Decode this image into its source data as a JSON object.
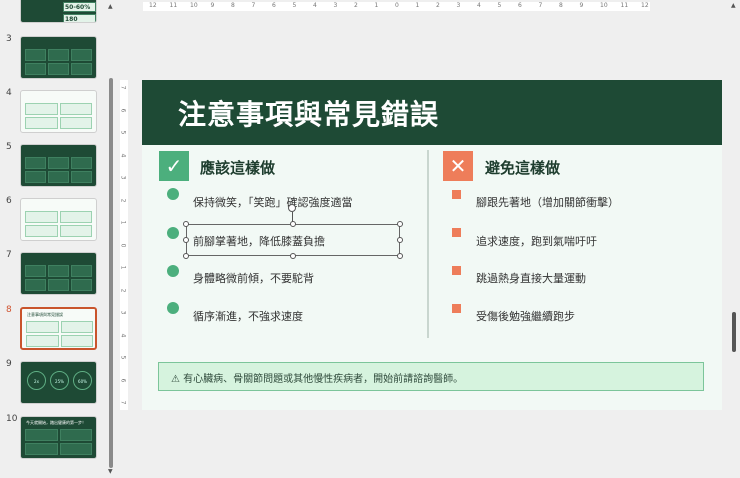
{
  "slides_panel": {
    "selected": 8,
    "thumbnails": [
      {
        "number": "3",
        "style": "dark"
      },
      {
        "number": "4",
        "style": "light"
      },
      {
        "number": "5",
        "style": "dark"
      },
      {
        "number": "6",
        "style": "light"
      },
      {
        "number": "7",
        "style": "dark"
      },
      {
        "number": "8",
        "style": "light",
        "title": "注意事項與常見錯誤"
      },
      {
        "number": "9",
        "style": "dark",
        "stats": [
          "2x",
          "25%",
          "60%"
        ]
      },
      {
        "number": "10",
        "style": "dark",
        "title": "今天就開始，踏出健康的第一步！"
      }
    ],
    "partial_slide2_values": [
      "50-60%",
      "180"
    ]
  },
  "ruler": {
    "horizontal": [
      "12",
      "11",
      "10",
      "9",
      "8",
      "7",
      "6",
      "5",
      "4",
      "3",
      "2",
      "1",
      "0",
      "1",
      "2",
      "3",
      "4",
      "5",
      "6",
      "7",
      "8",
      "9",
      "10",
      "11",
      "12"
    ],
    "vertical": [
      "7",
      "6",
      "5",
      "4",
      "3",
      "2",
      "1",
      "0",
      "1",
      "2",
      "3",
      "4",
      "5",
      "6",
      "7"
    ]
  },
  "slide": {
    "title": "注意事項與常見錯誤",
    "do": {
      "icon": "✓",
      "heading": "應該這樣做",
      "items": [
        "保持微笑，「笑跑」確認強度適當",
        "前腳掌著地，降低膝蓋負擔",
        "身體略微前傾，不要駝背",
        "循序漸進，不強求速度"
      ]
    },
    "dont": {
      "icon": "✕",
      "heading": "避免這樣做",
      "items": [
        "腳跟先著地（增加關節衝擊）",
        "追求速度，跑到氣喘吁吁",
        "跳過熱身直接大量運動",
        "受傷後勉強繼續跑步"
      ]
    },
    "warning": "⚠ 有心臟病、骨關節問題或其他慢性疾病者，開始前請諮詢醫師。"
  },
  "colors": {
    "dark_green": "#1e4a35",
    "green": "#4caf7d",
    "orange": "#ee7d5a",
    "selection": "#c9542c"
  }
}
